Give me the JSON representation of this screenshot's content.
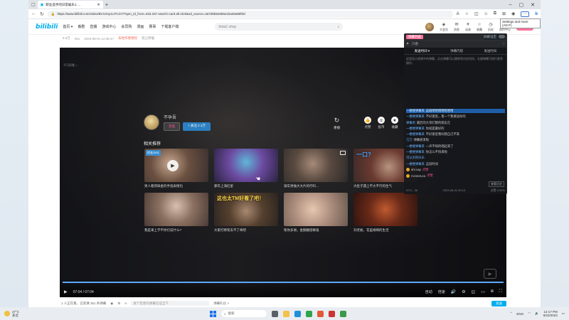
{
  "browser": {
    "tab_title": "职业选手的日常娱乐1: ...",
    "url": "https://www.bilibili.com/video/BV1X4y1U7CG7/?spm_id_from=333.337.search-card.all.click&vd_source=3a7d6b5e5b5e1ba30a89f3d",
    "tooltip": "Settings and more (Alt+F)"
  },
  "bili": {
    "logo": "bilibili",
    "nav": [
      "首页 ▾",
      "番剧",
      "直播",
      "游戏中心",
      "会员购",
      "漫画",
      "赛事",
      "下载客户端"
    ],
    "search_placeholder": "dota2 shop",
    "right_items": [
      "大会员",
      "消息",
      "动态",
      "收藏",
      "历史",
      "创作中心"
    ],
    "upload": "投稿"
  },
  "meta": {
    "views": "6.6万",
    "danmaku": "351",
    "date": "2023-08-01 12:35:47",
    "warning": "未经作者授权",
    "notice": "禁止转载"
  },
  "player": {
    "corner_text": "不可再看 >",
    "uploader_name": "不孕吾",
    "charge_label": "充电",
    "follow_label": "+ 关注 2.1万",
    "replay_label": "重播",
    "actions": [
      {
        "icon": "like-icon",
        "glyph": "👍",
        "label": "点赞"
      },
      {
        "icon": "coin-icon",
        "glyph": "◎",
        "label": "投币"
      },
      {
        "icon": "star-icon",
        "glyph": "★",
        "label": "收藏"
      }
    ],
    "recs_title": "相关推荐",
    "recs": [
      {
        "title": "男人看到缺金的手指表情包",
        "badge": "时长/3/01",
        "caption": ""
      },
      {
        "title": "那年上海红星",
        "badge": "",
        "caption": ""
      },
      {
        "title": "骑车男抛大大片的行吗…",
        "badge": "",
        "caption": ""
      },
      {
        "title": "大肚子遇上不大不行的生气",
        "badge": "",
        "caption": "一口?"
      },
      {
        "title": "我是来上学不你们说什么?",
        "badge": "",
        "caption": ""
      },
      {
        "title": "大家打绑架去不了奇吧",
        "badge": "",
        "caption": "这也太TM好看了吧！"
      },
      {
        "title": "帮你多谢，金额翻倍嘛鬼",
        "badge": "",
        "caption": ""
      },
      {
        "title": "刘老板，花里胡哨的生活",
        "badge": "",
        "caption": ""
      }
    ],
    "time": "07:04 / 07:04",
    "ctrl_right": [
      "自动",
      "倍速"
    ],
    "progress_fraction": 1.0
  },
  "danmaku": {
    "head_title": "弹幕列表",
    "head_right": "屏蔽设定",
    "sub_label": "只看",
    "tabs": [
      "发送时间 ▾",
      "弹幕内容",
      "发送时间"
    ],
    "description": "这里显示视频中的弹幕，点击弹幕可以跳转到对应时间，右键弹幕可进行更多操作。",
    "items": [
      {
        "user": "一楼楼弹幕来",
        "text": "这段哈哈哈哈哈哈哈",
        "tag": "",
        "hl": true
      },
      {
        "user": "一楼楼弹幕来",
        "text": "不好意思，第一个我要送你的",
        "tag": "",
        "hl": false
      },
      {
        "user": "弹幕君",
        "text": "最后的大哥们我的朋友在",
        "tag": "",
        "hl": false
      },
      {
        "user": "一楼楼弹幕来",
        "text": "你就是最好的",
        "tag": "",
        "hl": false
      },
      {
        "user": "一楼楼弹幕来",
        "text": "不好意思我叫我自己不来",
        "tag": "",
        "hl": false
      },
      {
        "user": "刀刀",
        "text": "弹幕君来啦",
        "tag": "",
        "hl": false
      },
      {
        "user": "一楼楼弹幕来",
        "text": "一声不响的唱起来了",
        "tag": "",
        "hl": false
      },
      {
        "user": "一楼楼弹幕来",
        "text": "你怎么不快来啦",
        "tag": "",
        "hl": false
      },
      {
        "user": "可以买的乐乐",
        "text": "",
        "tag": "",
        "hl": false
      },
      {
        "user": "一楼楼弹幕来",
        "text": "这段时间",
        "tag": "",
        "hl": false
      },
      {
        "user": "ahi.cap",
        "text": "点赞",
        "tag": "",
        "hl": false
      },
      {
        "user": "ContorLea",
        "text": "点赞",
        "tag": "",
        "hl": false
      }
    ],
    "bottom_left": "07:0…26",
    "bottom_mid": "2023-08-01 09:13",
    "bottom_right": "点赞 0.00%",
    "end_btn": "查看历史"
  },
  "bottom_bar": {
    "viewers": "1 人正在看，已装填 351 条弹幕",
    "input_placeholder": "发个友善的弹幕见证当下",
    "etiquette": "弹幕礼仪 >",
    "send": "发送"
  },
  "taskbar": {
    "weather_temp": "27°C",
    "weather_desc": "多云",
    "search_placeholder": "搜索",
    "time": "12:17 PM",
    "date": "8/22/2023",
    "lang": "ENG"
  },
  "desktop_ghost_left": "",
  "desktop_ghost_right": ""
}
